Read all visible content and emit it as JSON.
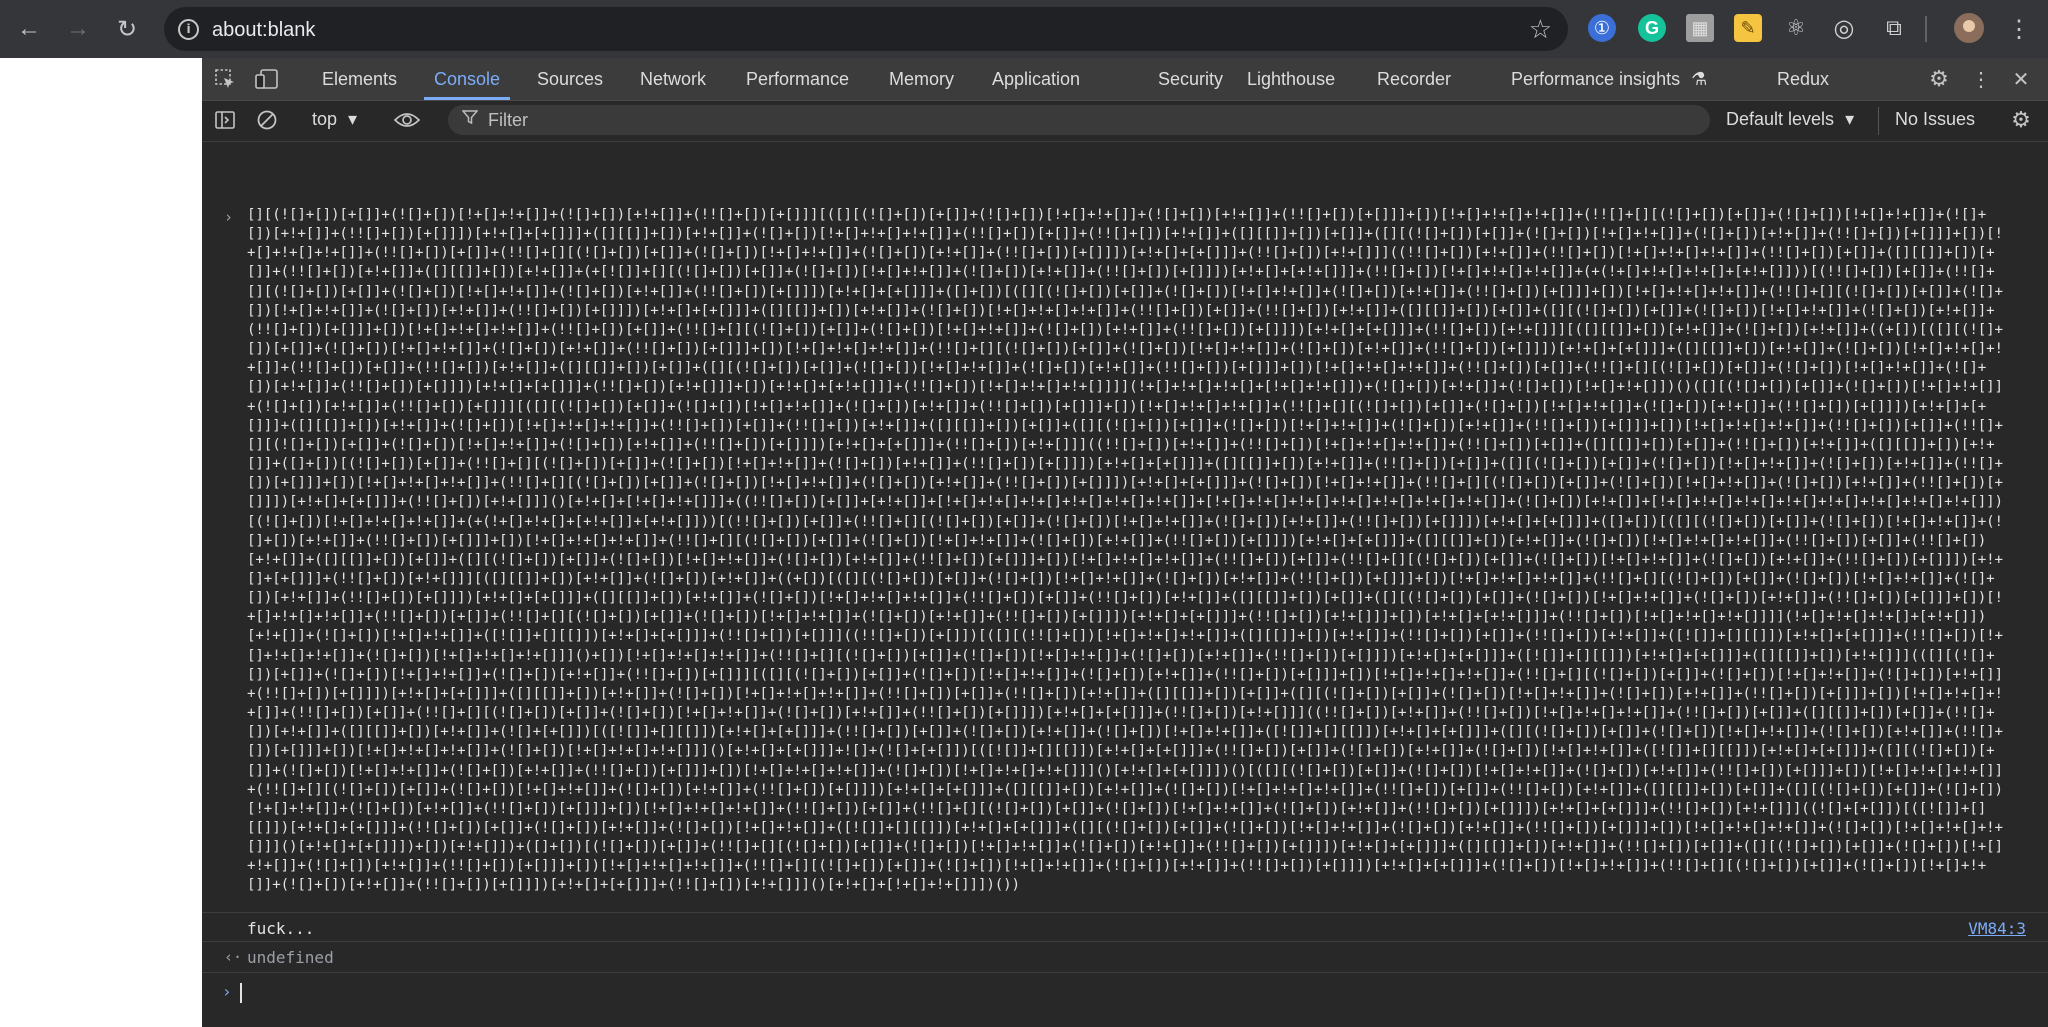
{
  "browser": {
    "url": "about:blank",
    "back_icon": "←",
    "forward_icon": "→",
    "reload_icon": "↻",
    "star_icon": "☆",
    "extensions": [
      {
        "name": "1password-icon",
        "glyph": "①"
      },
      {
        "name": "grammarly-icon",
        "glyph": "G"
      },
      {
        "name": "extension-tile-icon",
        "glyph": "▦"
      },
      {
        "name": "notes-extension-icon",
        "glyph": "✎"
      },
      {
        "name": "react-devtools-icon",
        "glyph": "⚛"
      },
      {
        "name": "target-extension-icon",
        "glyph": "◎"
      },
      {
        "name": "puzzle-extensions-icon",
        "glyph": "⧉"
      }
    ],
    "menu_icon": "⋮"
  },
  "devtools": {
    "tabs": [
      "Elements",
      "Console",
      "Sources",
      "Network",
      "Performance",
      "Memory",
      "Application",
      "Security",
      "Lighthouse",
      "Recorder",
      "Performance insights",
      "Redux"
    ],
    "active_tab": "Console",
    "insights_flask_icon": "⚗",
    "settings_icon": "⚙",
    "more_icon": "⋮",
    "close_icon": "✕"
  },
  "console_bar": {
    "context": "top",
    "context_caret": "▾",
    "filter_placeholder": "Filter",
    "levels": "Default levels",
    "levels_caret": "▾",
    "issues": "No Issues"
  },
  "console": {
    "command_prompt": "›",
    "command_code": "[][(![]+[])[+[]]+(![]+[])[!+[]+!+[]]+(![]+[])[+!+[]]+(!![]+[])[+[]]][([][(![]+[])[+[]]+(![]+[])[!+[]+!+[]]+(![]+[])[+!+[]]+(!![]+[])[+[]]]+[])[!+[]+!+[]+!+[]]+(!![]+[][(![]+[])[+[]]+(![]+[])[!+[]+!+[]]+(![]+[])[+!+[]]+(!![]+[])[+[]]])[+!+[]+[+[]]]+([][[]]+[])[+!+[]]+(![]+[])[!+[]+!+[]+!+[]]+(!![]+[])[+[]]+(!![]+[])[+!+[]]+([][[]]+[])[+[]]+([][(![]+[])[+[]]+(![]+[])[!+[]+!+[]]+(![]+[])[+!+[]]+(!![]+[])[+[]]]+[])[!+[]+!+[]+!+[]]+(!![]+[])[+[]]+(!![]+[][(![]+[])[+[]]+(![]+[])[!+[]+!+[]]+(![]+[])[+!+[]]+(!![]+[])[+[]]])[+!+[]+[+[]]]+(!![]+[])[+!+[]]]((!![]+[])[+!+[]]+(!![]+[])[!+[]+!+[]+!+[]]+(!![]+[])[+[]]+([][[]]+[])[+[]]+(!![]+[])[+!+[]]+([][[]]+[])[+!+[]]+(+[![]]+[][(![]+[])[+[]]+(![]+[])[!+[]+!+[]]+(![]+[])[+!+[]]+(!![]+[])[+[]]])[+!+[]+[+!+[]]]+(!![]+[])[!+[]+!+[]+!+[]]+(+(!+[]+!+[]+!+[]+[+!+[]]))[(!![]+[])[+[]]+(!![]+[][(![]+[])[+[]]+(![]+[])[!+[]+!+[]]+(![]+[])[+!+[]]+(!![]+[])[+[]]])[+!+[]+[+[]]]+([]+[])[([][(![]+[])[+[]]+(![]+[])[!+[]+!+[]]+(![]+[])[+!+[]]+(!![]+[])[+[]]]+[])[!+[]+!+[]+!+[]]+(!![]+[][(![]+[])[+[]]+(![]+[])[!+[]+!+[]]+(![]+[])[+!+[]]+(!![]+[])[+[]]])[+!+[]+[+[]]]+([][[]]+[])[+!+[]]+(![]+[])[!+[]+!+[]+!+[]]+(!![]+[])[+[]]+(!![]+[])[+!+[]]+([][[]]+[])[+[]]+([][(![]+[])[+[]]+(![]+[])[!+[]+!+[]]+(![]+[])[+!+[]]+(!![]+[])[+[]]]+[])[!+[]+!+[]+!+[]]+(!![]+[])[+[]]+(!![]+[][(![]+[])[+[]]+(![]+[])[!+[]+!+[]]+(![]+[])[+!+[]]+(!![]+[])[+[]]])[+!+[]+[+[]]]+(!![]+[])[+!+[]]][([][[]]+[])[+!+[]]+(![]+[])[+!+[]]+((+[])[([][(![]+[])[+[]]+(![]+[])[!+[]+!+[]]+(![]+[])[+!+[]]+(!![]+[])[+[]]]+[])[!+[]+!+[]+!+[]]+(!![]+[][(![]+[])[+[]]+(![]+[])[!+[]+!+[]]+(![]+[])[+!+[]]+(!![]+[])[+[]]])[+!+[]+[+[]]]+([][[]]+[])[+!+[]]+(![]+[])[!+[]+!+[]+!+[]]+(!![]+[])[+[]]+(!![]+[])[+!+[]]+([][[]]+[])[+[]]+([][(![]+[])[+[]]+(![]+[])[!+[]+!+[]]+(![]+[])[+!+[]]+(!![]+[])[+[]]]+[])[!+[]+!+[]+!+[]]+(!![]+[])[+[]]+(!![]+[][(![]+[])[+[]]+(![]+[])[!+[]+!+[]]+(![]+[])[+!+[]]+(!![]+[])[+[]]])[+!+[]+[+[]]]+(!![]+[])[+!+[]]]+[])[+!+[]+[+!+[]]]+(!![]+[])[!+[]+!+[]+!+[]]]](!+[]+!+[]+!+[]+[!+[]+!+[]])+(![]+[])[+!+[]]+(![]+[])[!+[]+!+[]])()([][(![]+[])[+[]]+(![]+[])[!+[]+!+[]]+(![]+[])[+!+[]]+(!![]+[])[+[]]][([][(![]+[])[+[]]+(![]+[])[!+[]+!+[]]+(![]+[])[+!+[]]+(!![]+[])[+[]]]+[])[!+[]+!+[]+!+[]]+(!![]+[][(![]+[])[+[]]+(![]+[])[!+[]+!+[]]+(![]+[])[+!+[]]+(!![]+[])[+[]]])[+!+[]+[+[]]]+([][[]]+[])[+!+[]]+(![]+[])[!+[]+!+[]+!+[]]+(!![]+[])[+[]]+(!![]+[])[+!+[]]+([][[]]+[])[+[]]+([][(![]+[])[+[]]+(![]+[])[!+[]+!+[]]+(![]+[])[+!+[]]+(!![]+[])[+[]]]+[])[!+[]+!+[]+!+[]]+(!![]+[])[+[]]+(!![]+[][(![]+[])[+[]]+(![]+[])[!+[]+!+[]]+(![]+[])[+!+[]]+(!![]+[])[+[]]])[+!+[]+[+[]]]+(!![]+[])[+!+[]]]((!![]+[])[+!+[]]+(!![]+[])[!+[]+!+[]+!+[]]+(!![]+[])[+[]]+([][[]]+[])[+[]]+(!![]+[])[+!+[]]+([][[]]+[])[+!+[]]+([]+[])[(![]+[])[+[]]+(!![]+[][(![]+[])[+[]]+(![]+[])[!+[]+!+[]]+(![]+[])[+!+[]]+(!![]+[])[+[]]])[+!+[]+[+[]]]+([][[]]+[])[+!+[]]+(!![]+[])[+[]]+([][(![]+[])[+[]]+(![]+[])[!+[]+!+[]]+(![]+[])[+!+[]]+(!![]+[])[+[]]]+[])[!+[]+!+[]+!+[]]+(!![]+[][(![]+[])[+[]]+(![]+[])[!+[]+!+[]]+(![]+[])[+!+[]]+(!![]+[])[+[]]])[+!+[]+[+[]]]+(![]+[])[!+[]+!+[]]+(!![]+[][(![]+[])[+[]]+(![]+[])[!+[]+!+[]]+(![]+[])[+!+[]]+(!![]+[])[+[]]])[+!+[]+[+[]]]+(!![]+[])[+!+[]]]()[+!+[]+[!+[]+!+[]]]+((!![]+[])[+[]]+[+!+[]]+[!+[]+!+[]+!+[]+!+[]+!+[]+!+[]]+[!+[]+!+[]+!+[]+!+[]+!+[]+!+[]+!+[]]+(![]+[])[+!+[]]+[!+[]+!+[]+!+[]+!+[]+!+[]+!+[]+!+[]+!+[]])[(![]+[])[!+[]+!+[]+!+[]]+(+(!+[]+!+[]+[+!+[]]+[+!+[]]))[(!![]+[])[+[]]+(!![]+[][(![]+[])[+[]]+(![]+[])[!+[]+!+[]]+(![]+[])[+!+[]]+(!![]+[])[+[]]])[+!+[]+[+[]]]+([]+[])[([][(![]+[])[+[]]+(![]+[])[!+[]+!+[]]+(![]+[])[+!+[]]+(!![]+[])[+[]]]+[])[!+[]+!+[]+!+[]]+(!![]+[][(![]+[])[+[]]+(![]+[])[!+[]+!+[]]+(![]+[])[+!+[]]+(!![]+[])[+[]]])[+!+[]+[+[]]]+([][[]]+[])[+!+[]]+(![]+[])[!+[]+!+[]+!+[]]+(!![]+[])[+[]]+(!![]+[])[+!+[]]+([][[]]+[])[+[]]+([][(![]+[])[+[]]+(![]+[])[!+[]+!+[]]+(![]+[])[+!+[]]+(!![]+[])[+[]]]+[])[!+[]+!+[]+!+[]]+(!![]+[])[+[]]+(!![]+[][(![]+[])[+[]]+(![]+[])[!+[]+!+[]]+(![]+[])[+!+[]]+(!![]+[])[+[]]])[+!+[]+[+[]]]+(!![]+[])[+!+[]]][([][[]]+[])[+!+[]]+(![]+[])[+!+[]]+((+[])[([][(![]+[])[+[]]+(![]+[])[!+[]+!+[]]+(![]+[])[+!+[]]+(!![]+[])[+[]]]+[])[!+[]+!+[]+!+[]]+(!![]+[][(![]+[])[+[]]+(![]+[])[!+[]+!+[]]+(![]+[])[+!+[]]+(!![]+[])[+[]]])[+!+[]+[+[]]]+([][[]]+[])[+!+[]]+(![]+[])[!+[]+!+[]+!+[]]+(!![]+[])[+[]]+(!![]+[])[+!+[]]+([][[]]+[])[+[]]+([][(![]+[])[+[]]+(![]+[])[!+[]+!+[]]+(![]+[])[+!+[]]+(!![]+[])[+[]]]+[])[!+[]+!+[]+!+[]]+(!![]+[])[+[]]+(!![]+[][(![]+[])[+[]]+(![]+[])[!+[]+!+[]]+(![]+[])[+!+[]]+(!![]+[])[+[]]])[+!+[]+[+[]]]+(!![]+[])[+!+[]]]+[])[+!+[]+[+!+[]]]+(!![]+[])[!+[]+!+[]+!+[]]]](!+[]+!+[]+!+[]+[+!+[]])[+!+[]]+(![]+[])[!+[]+!+[]]+([![]]+[][[]])[+!+[]+[+[]]]+(!![]+[])[+[]]]((!![]+[])[+[]])[([][(!![]+[])[!+[]+!+[]+!+[]]+([][[]]+[])[+!+[]]+(!![]+[])[+[]]+(!![]+[])[+!+[]]+([![]]+[][[]])[+!+[]+[+[]]]+(!![]+[])[!+[]+!+[]+!+[]]+(![]+[])[!+[]+!+[]+!+[]]]()+[])[!+[]+!+[]+!+[]]+(!![]+[][(![]+[])[+[]]+(![]+[])[!+[]+!+[]]+(![]+[])[+!+[]]+(!![]+[])[+[]]])[+!+[]+[+[]]]+([![]]+[][[]])[+!+[]+[+[]]]+([][[]]+[])[+!+[]]](([][(![]+[])[+[]]+(![]+[])[!+[]+!+[]]+(![]+[])[+!+[]]+(!![]+[])[+[]]][([][(![]+[])[+[]]+(![]+[])[!+[]+!+[]]+(![]+[])[+!+[]]+(!![]+[])[+[]]]+[])[!+[]+!+[]+!+[]]+(!![]+[][(![]+[])[+[]]+(![]+[])[!+[]+!+[]]+(![]+[])[+!+[]]+(!![]+[])[+[]]])[+!+[]+[+[]]]+([][[]]+[])[+!+[]]+(![]+[])[!+[]+!+[]+!+[]]+(!![]+[])[+[]]+(!![]+[])[+!+[]]+([][[]]+[])[+[]]+([][(![]+[])[+[]]+(![]+[])[!+[]+!+[]]+(![]+[])[+!+[]]+(!![]+[])[+[]]]+[])[!+[]+!+[]+!+[]]+(!![]+[])[+[]]+(!![]+[][(![]+[])[+[]]+(![]+[])[!+[]+!+[]]+(![]+[])[+!+[]]+(!![]+[])[+[]]])[+!+[]+[+[]]]+(!![]+[])[+!+[]]]((!![]+[])[+!+[]]+(!![]+[])[!+[]+!+[]+!+[]]+(!![]+[])[+[]]+([][[]]+[])[+[]]+(!![]+[])[+!+[]]+([][[]]+[])[+!+[]]+(![]+[+[]])[([![]]+[][[]])[+!+[]+[+[]]]+(!![]+[])[+[]]+(![]+[])[+!+[]]+(![]+[])[!+[]+!+[]]+([![]]+[][[]])[+!+[]+[+[]]]+([][(![]+[])[+[]]+(![]+[])[!+[]+!+[]]+(![]+[])[+!+[]]+(!![]+[])[+[]]]+[])[!+[]+!+[]+!+[]]+(![]+[])[!+[]+!+[]+!+[]]]()[+!+[]+[+[]]]+![]+(![]+[+[]])[([![]]+[][[]])[+!+[]+[+[]]]+(!![]+[])[+[]]+(![]+[])[+!+[]]+(![]+[])[!+[]+!+[]]+([![]]+[][[]])[+!+[]+[+[]]]+([][(![]+[])[+[]]+(![]+[])[!+[]+!+[]]+(![]+[])[+!+[]]+(!![]+[])[+[]]]+[])[!+[]+!+[]+!+[]]+(![]+[])[!+[]+!+[]+!+[]]]()[+!+[]+[+[]]])()[([][(![]+[])[+[]]+(![]+[])[!+[]+!+[]]+(![]+[])[+!+[]]+(!![]+[])[+[]]]+[])[!+[]+!+[]+!+[]]+(!![]+[][(![]+[])[+[]]+(![]+[])[!+[]+!+[]]+(![]+[])[+!+[]]+(!![]+[])[+[]]])[+!+[]+[+[]]]+([][[]]+[])[+!+[]]+(![]+[])[!+[]+!+[]+!+[]]+(!![]+[])[+[]]+(!![]+[])[+!+[]]+([][[]]+[])[+[]]+([][(![]+[])[+[]]+(![]+[])[!+[]+!+[]]+(![]+[])[+!+[]]+(!![]+[])[+[]]]+[])[!+[]+!+[]+!+[]]+(!![]+[])[+[]]+(!![]+[][(![]+[])[+[]]+(![]+[])[!+[]+!+[]]+(![]+[])[+!+[]]+(!![]+[])[+[]]])[+!+[]+[+[]]]+(!![]+[])[+!+[]]]((![]+[+[]])[([![]]+[][[]])[+!+[]+[+[]]]+(!![]+[])[+[]]+(![]+[])[+!+[]]+(![]+[])[!+[]+!+[]]+([![]]+[][[]])[+!+[]+[+[]]]+([][(![]+[])[+[]]+(![]+[])[!+[]+!+[]]+(![]+[])[+!+[]]+(!![]+[])[+[]]]+[])[!+[]+!+[]+!+[]]+(![]+[])[!+[]+!+[]+!+[]]]()[+!+[]+[+[]]])+[])[+!+[]])+([]+[])[(![]+[])[+[]]+(!![]+[][(![]+[])[+[]]+(![]+[])[!+[]+!+[]]+(![]+[])[+!+[]]+(!![]+[])[+[]]])[+!+[]+[+[]]]+([][[]]+[])[+!+[]]+(!![]+[])[+[]]+([][(![]+[])[+[]]+(![]+[])[!+[]+!+[]]+(![]+[])[+!+[]]+(!![]+[])[+[]]]+[])[!+[]+!+[]+!+[]]+(!![]+[][(![]+[])[+[]]+(![]+[])[!+[]+!+[]]+(![]+[])[+!+[]]+(!![]+[])[+[]]])[+!+[]+[+[]]]+(![]+[])[!+[]+!+[]]+(!![]+[][(![]+[])[+[]]+(![]+[])[!+[]+!+[]]+(![]+[])[+!+[]]+(!![]+[])[+[]]])[+!+[]+[+[]]]+(!![]+[])[+!+[]]]()[+!+[]+[!+[]+!+[]]])())",
    "log_message": "fuck...",
    "log_source": "VM84:3",
    "result_arrow": "‹·",
    "result_value": "undefined",
    "input_prompt": "›"
  }
}
